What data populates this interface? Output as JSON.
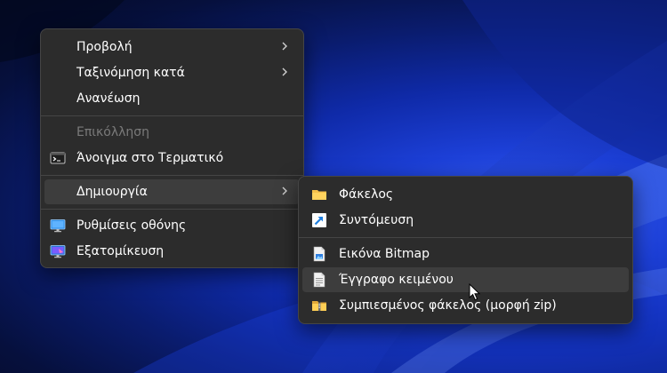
{
  "context_menu": {
    "items": [
      {
        "label": "Προβολή",
        "submenu": true
      },
      {
        "label": "Ταξινόμηση κατά",
        "submenu": true
      },
      {
        "label": "Ανανέωση"
      },
      {
        "label": "Επικόλληση",
        "disabled": true
      },
      {
        "label": "Άνοιγμα στο Τερματικό",
        "icon": "terminal-icon"
      },
      {
        "label": "Δημιουργία",
        "submenu": true,
        "active": true
      },
      {
        "label": "Ρυθμίσεις οθόνης",
        "icon": "monitor-icon"
      },
      {
        "label": "Εξατομίκευση",
        "icon": "personalize-icon"
      }
    ]
  },
  "new_submenu": {
    "items": [
      {
        "label": "Φάκελος",
        "icon": "folder-icon"
      },
      {
        "label": "Συντόμευση",
        "icon": "shortcut-icon"
      },
      {
        "label": "Εικόνα Bitmap",
        "icon": "bitmap-file-icon"
      },
      {
        "label": "Έγγραφο κειμένου",
        "icon": "text-document-icon",
        "hovered": true
      },
      {
        "label": "Συμπιεσμένος φάκελος (μορφή zip)",
        "icon": "zip-folder-icon"
      }
    ]
  },
  "colors": {
    "menu_background": "#2c2c2c",
    "menu_border": "#454545",
    "highlight": "#3d3d3d",
    "folder": "#f5c04a",
    "shortcut_arrow": "#4aa8ff"
  }
}
